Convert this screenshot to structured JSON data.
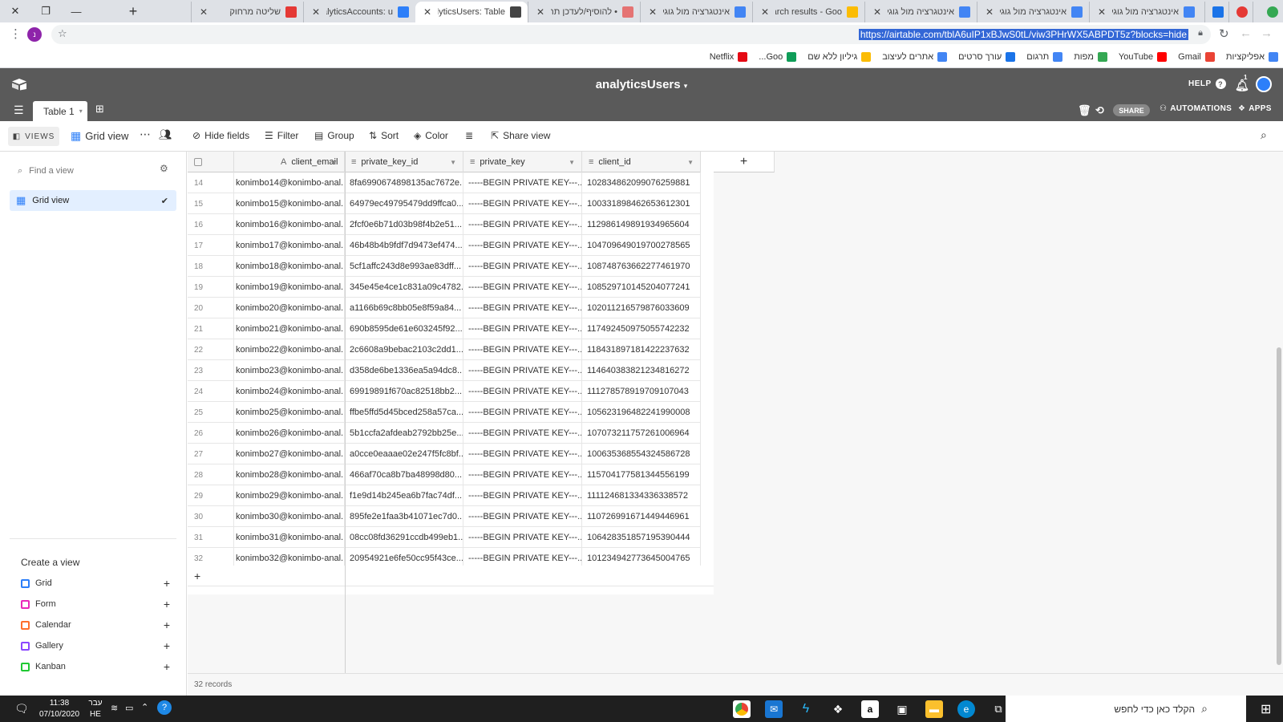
{
  "browser": {
    "tabs": [
      {
        "title": "אינטגרציה מול גוגל",
        "favicon_color": "#4285f4",
        "active": false
      },
      {
        "title": "אינטגרציה מול גוגל",
        "favicon_color": "#4285f4",
        "active": false
      },
      {
        "title": "אינטגרציה מול גוגל",
        "favicon_color": "#4285f4",
        "active": false
      },
      {
        "title": "Search results - Goo",
        "favicon_color": "#fbbc04",
        "active": false
      },
      {
        "title": "אינטגרציה מול גוגל",
        "favicon_color": "#4285f4",
        "active": false
      },
      {
        "title": "• להוסיף/לעדכן תה",
        "favicon_color": "#e57373",
        "active": false
      },
      {
        "title": "analyticsUsers: Table",
        "favicon_color": "#444444",
        "active": true
      },
      {
        "title": "analyticsAccounts: u",
        "favicon_color": "#2d7ff9",
        "active": false
      },
      {
        "title": "שליטה מרחוק",
        "favicon_color": "#e53935",
        "active": false
      }
    ],
    "url": "https://airtable.com/tblA6uIP1xBJwS0tL/viw3PHrWX5ABPDT5z?blocks=hide",
    "bookmarks": [
      {
        "label": "אפליקציות",
        "icon_color": "#4285f4"
      },
      {
        "label": "Gmail",
        "icon_color": "#ea4335"
      },
      {
        "label": "YouTube",
        "icon_color": "#ff0000"
      },
      {
        "label": "מפות",
        "icon_color": "#34a853"
      },
      {
        "label": "תרגום",
        "icon_color": "#4285f4"
      },
      {
        "label": "עורך סרטים",
        "icon_color": "#1a73e8"
      },
      {
        "label": "אתרים לעיצוב",
        "icon_color": "#4285f4"
      },
      {
        "label": "גיליון ללא שם",
        "icon_color": "#fbbc04"
      },
      {
        "label": "Goo...",
        "icon_color": "#0f9d58"
      },
      {
        "label": "Netflix",
        "icon_color": "#e50914"
      }
    ]
  },
  "app": {
    "base_title": "analyticsUsers",
    "help_label": "HELP",
    "notif_count": "1",
    "table_tab": "Table 1",
    "share_label": "SHARE",
    "automations_label": "AUTOMATIONS",
    "apps_label": "APPS"
  },
  "viewbar": {
    "views_label": "VIEWS",
    "view_name": "Grid view",
    "hide_fields": "Hide fields",
    "filter": "Filter",
    "group": "Group",
    "sort": "Sort",
    "color": "Color",
    "share_view": "Share view"
  },
  "sidebar": {
    "find_placeholder": "Find a view",
    "current_view": "Grid view",
    "create_title": "Create a view",
    "create_items": [
      {
        "label": "Grid",
        "color": "#2d7ff9"
      },
      {
        "label": "Form",
        "color": "#e929ba"
      },
      {
        "label": "Calendar",
        "color": "#ff6f2c"
      },
      {
        "label": "Gallery",
        "color": "#8b46ff"
      },
      {
        "label": "Kanban",
        "color": "#20c933"
      }
    ]
  },
  "grid": {
    "columns": [
      {
        "name": "client_email",
        "type_icon": "A"
      },
      {
        "name": "private_key_id",
        "type_icon": "≡"
      },
      {
        "name": "private_key",
        "type_icon": "≡"
      },
      {
        "name": "client_id",
        "type_icon": "≡"
      }
    ],
    "rows": [
      [
        "14",
        "konimbo14@konimbo-anal...",
        "8fa6990674898135ac7672e...",
        "-----BEGIN PRIVATE KEY---...",
        "102834862099076259881"
      ],
      [
        "15",
        "konimbo15@konimbo-anal...",
        "64979ec49795479dd9ffca0...",
        "-----BEGIN PRIVATE KEY---...",
        "100331898462653612301"
      ],
      [
        "16",
        "konimbo16@konimbo-anal...",
        "2fcf0e6b71d03b98f4b2e51...",
        "-----BEGIN PRIVATE KEY---...",
        "112986149891934965604"
      ],
      [
        "17",
        "konimbo17@konimbo-anal...",
        "46b48b4b9fdf7d9473ef474...",
        "-----BEGIN PRIVATE KEY---...",
        "104709649019700278565"
      ],
      [
        "18",
        "konimbo18@konimbo-anal...",
        "5cf1affc243d8e993ae83dff...",
        "-----BEGIN PRIVATE KEY---...",
        "108748763662277461970"
      ],
      [
        "19",
        "konimbo19@konimbo-anal...",
        "345e45e4ce1c831a09c4782...",
        "-----BEGIN PRIVATE KEY---...",
        "108529710145204077241"
      ],
      [
        "20",
        "konimbo20@konimbo-anal...",
        "a1166b69c8bb05e8f59a84...",
        "-----BEGIN PRIVATE KEY---...",
        "102011216579876033609"
      ],
      [
        "21",
        "konimbo21@konimbo-anal...",
        "690b8595de61e603245f92...",
        "-----BEGIN PRIVATE KEY---...",
        "117492450975055742232"
      ],
      [
        "22",
        "konimbo22@konimbo-anal...",
        "2c6608a9bebac2103c2dd1...",
        "-----BEGIN PRIVATE KEY---...",
        "118431897181422237632"
      ],
      [
        "23",
        "konimbo23@konimbo-anal...",
        "d358de6be1336ea5a94dc8...",
        "-----BEGIN PRIVATE KEY---...",
        "114640383821234816272"
      ],
      [
        "24",
        "konimbo24@konimbo-anal...",
        "69919891f670ac82518bb2...",
        "-----BEGIN PRIVATE KEY---...",
        "111278578919709107043"
      ],
      [
        "25",
        "konimbo25@konimbo-anal...",
        "ffbe5ffd5d45bced258a57ca...",
        "-----BEGIN PRIVATE KEY---...",
        "105623196482241990008"
      ],
      [
        "26",
        "konimbo26@konimbo-anal...",
        "5b1ccfa2afdeab2792bb25e...",
        "-----BEGIN PRIVATE KEY---...",
        "107073211757261006964"
      ],
      [
        "27",
        "konimbo27@konimbo-anal...",
        "a0cce0eaaae02e247f5fc8bf...",
        "-----BEGIN PRIVATE KEY---...",
        "100635368554324586728"
      ],
      [
        "28",
        "konimbo28@konimbo-anal...",
        "466af70ca8b7ba48998d80...",
        "-----BEGIN PRIVATE KEY---...",
        "115704177581344556199"
      ],
      [
        "29",
        "konimbo29@konimbo-anal...",
        "f1e9d14b245ea6b7fac74df...",
        "-----BEGIN PRIVATE KEY---...",
        "111124681334336338572"
      ],
      [
        "30",
        "konimbo30@konimbo-anal...",
        "895fe2e1faa3b41071ec7d0...",
        "-----BEGIN PRIVATE KEY---...",
        "110726991671449446961"
      ],
      [
        "31",
        "konimbo31@konimbo-anal...",
        "08cc08fd36291ccdb499eb1...",
        "-----BEGIN PRIVATE KEY---...",
        "106428351857195390444"
      ],
      [
        "32",
        "konimbo32@konimbo-anal...",
        "20954921e6fe50cc95f43ce...",
        "-----BEGIN PRIVATE KEY---...",
        "101234942773645004765"
      ]
    ],
    "record_count": "32 records"
  },
  "taskbar": {
    "search_placeholder": "הקלד כאן כדי לחפש",
    "time": "11:38",
    "date": "07/10/2020",
    "lang_top": "עבר",
    "lang_bottom": "HE"
  }
}
